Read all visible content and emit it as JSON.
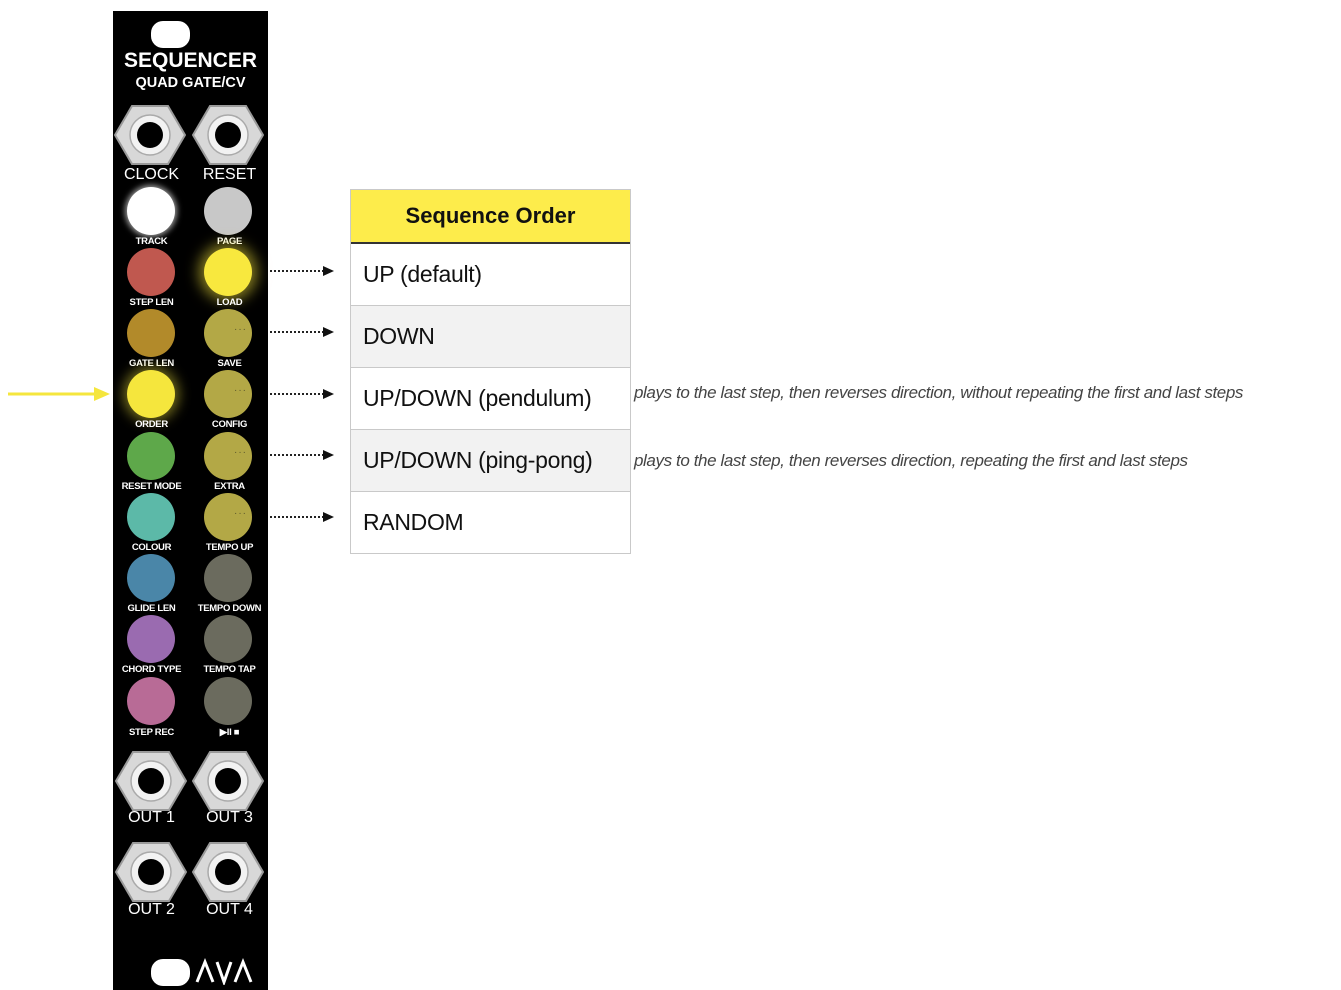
{
  "module": {
    "title": "SEQUENCER",
    "subtitle": "QUAD GATE/CV",
    "jacks_top": [
      "CLOCK",
      "RESET"
    ],
    "buttons": [
      {
        "left_label": "TRACK",
        "right_label": "PAGE"
      },
      {
        "left_label": "STEP LEN",
        "right_label": "LOAD"
      },
      {
        "left_label": "GATE LEN",
        "right_label": "SAVE"
      },
      {
        "left_label": "ORDER",
        "right_label": "CONFIG"
      },
      {
        "left_label": "RESET MODE",
        "right_label": "EXTRA"
      },
      {
        "left_label": "COLOUR",
        "right_label": "TEMPO UP"
      },
      {
        "left_label": "GLIDE LEN",
        "right_label": "TEMPO DOWN"
      },
      {
        "left_label": "CHORD TYPE",
        "right_label": "TEMPO TAP"
      },
      {
        "left_label": "STEP REC",
        "right_label": "▶II ■"
      }
    ],
    "jacks_bottom": [
      "OUT 1",
      "OUT 3",
      "OUT 2",
      "OUT 4"
    ],
    "colors": {
      "clock_btn": "#ffffff",
      "reset_btn": "#c8c8c8",
      "track": "#c0584f",
      "step_len": "#b28a2a",
      "gate_len": "#f5e63d",
      "order": "#5ea84a",
      "reset_mode": "#5cb9a8",
      "colour": "#4a86a8",
      "glide_len": "#9a6bb0",
      "chord_type": "#b86b96",
      "page_lit": "#f8e83e",
      "dim_yellow": "#b3a846",
      "off_gray": "#6b6b5e"
    }
  },
  "table": {
    "header": "Sequence Order",
    "rows": [
      {
        "label": "UP (default)",
        "note": ""
      },
      {
        "label": "DOWN",
        "note": ""
      },
      {
        "label": "UP/DOWN (pendulum)",
        "note": "plays to the last step, then reverses direction, without repeating the first and last steps"
      },
      {
        "label": "UP/DOWN (ping-pong)",
        "note": "plays to the last step, then reverses direction, repeating the first and last steps"
      },
      {
        "label": "RANDOM",
        "note": ""
      }
    ]
  },
  "accent_color": "#fdec4b"
}
